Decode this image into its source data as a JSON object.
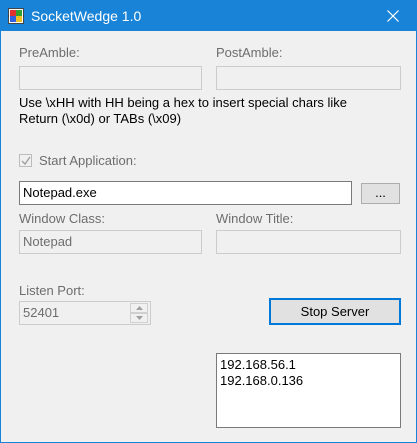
{
  "window": {
    "title": "SocketWedge 1.0"
  },
  "preamble": {
    "label": "PreAmble:",
    "value": ""
  },
  "postamble": {
    "label": "PostAmble:",
    "value": ""
  },
  "hint": {
    "line1": "Use \\xHH with HH being a hex to insert special chars like",
    "line2": "Return (\\x0d) or TABs (\\x09)"
  },
  "start_app": {
    "label": "Start Application:",
    "checked": true
  },
  "app_path": {
    "value": "Notepad.exe"
  },
  "browse_button": {
    "label": "..."
  },
  "window_class": {
    "label": "Window Class:",
    "value": "Notepad"
  },
  "window_title": {
    "label": "Window Title:",
    "value": ""
  },
  "listen_port": {
    "label": "Listen Port:",
    "value": "52401"
  },
  "server_button": {
    "label": "Stop Server"
  },
  "ip_list": {
    "items": [
      "192.168.56.1",
      "192.168.0.136"
    ]
  },
  "colors": {
    "titlebar": "#1883d7",
    "accent": "#0078d7",
    "background": "#f0f0f0"
  }
}
